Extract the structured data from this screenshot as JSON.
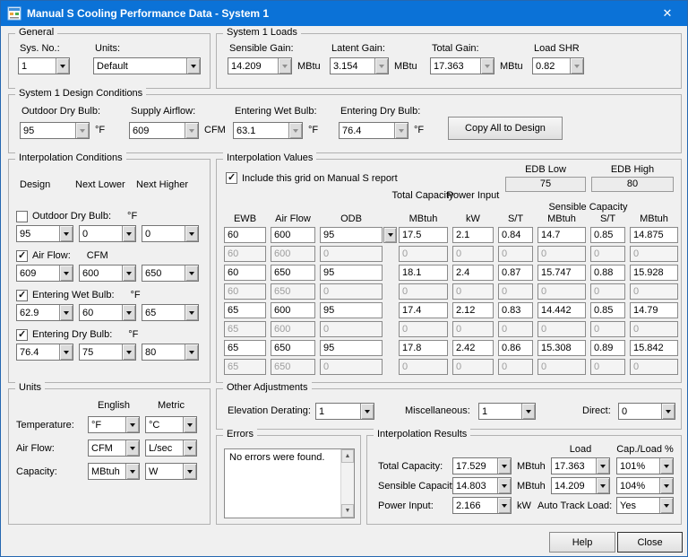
{
  "colors": {
    "titlebar": "#0b72d7",
    "dialog_bg": "#f0f0f0"
  },
  "titlebar": {
    "title": "Manual S Cooling Performance Data - System 1",
    "close_glyph": "✕"
  },
  "general": {
    "legend": "General",
    "sys_no_label": "Sys. No.:",
    "sys_no_value": "1",
    "units_label": "Units:",
    "units_value": "Default"
  },
  "loads": {
    "legend": "System 1 Loads",
    "sensible_label": "Sensible Gain:",
    "sensible_value": "14.209",
    "sensible_unit": "MBtu",
    "latent_label": "Latent Gain:",
    "latent_value": "3.154",
    "latent_unit": "MBtu",
    "total_label": "Total Gain:",
    "total_value": "17.363",
    "total_unit": "MBtu",
    "shr_label": "Load SHR",
    "shr_value": "0.82"
  },
  "design": {
    "legend": "System 1 Design Conditions",
    "odb_label": "Outdoor Dry Bulb:",
    "odb_value": "95",
    "odb_unit": "°F",
    "airflow_label": "Supply Airflow:",
    "airflow_value": "609",
    "airflow_unit": "CFM",
    "ewb_label": "Entering Wet Bulb:",
    "ewb_value": "63.1",
    "ewb_unit": "°F",
    "edb_label": "Entering Dry Bulb:",
    "edb_value": "76.4",
    "edb_unit": "°F",
    "copy_button": "Copy All to Design"
  },
  "interp_conditions": {
    "legend": "Interpolation Conditions",
    "headers": {
      "design": "Design",
      "lower": "Next Lower",
      "higher": "Next Higher"
    },
    "rows": [
      {
        "label": "Outdoor Dry Bulb:",
        "unit": "°F",
        "checked": false,
        "design": "95",
        "lower": "0",
        "higher": "0"
      },
      {
        "label": "Air Flow:",
        "unit": "CFM",
        "checked": true,
        "design": "609",
        "lower": "600",
        "higher": "650"
      },
      {
        "label": "Entering Wet Bulb:",
        "unit": "°F",
        "checked": true,
        "design": "62.9",
        "lower": "60",
        "higher": "65"
      },
      {
        "label": "Entering Dry Bulb:",
        "unit": "°F",
        "checked": true,
        "design": "76.4",
        "lower": "75",
        "higher": "80"
      }
    ]
  },
  "interp_values": {
    "legend": "Interpolation Values",
    "include_label": "Include this grid on Manual S report",
    "include_checked": true,
    "edb_low_label": "EDB Low",
    "edb_high_label": "EDB High",
    "edb_low_value": "75",
    "edb_high_value": "80",
    "group_total": "Total Capacity",
    "group_power": "Power Input",
    "group_sensible": "Sensible Capacity",
    "col_headers": [
      "EWB",
      "Air Flow",
      "ODB",
      "MBtuh",
      "kW",
      "S/T",
      "MBtuh",
      "S/T",
      "MBtuh"
    ],
    "rows": [
      {
        "disabled": false,
        "cells": [
          "60",
          "600",
          "95",
          "17.5",
          "2.1",
          "0.84",
          "14.7",
          "0.85",
          "14.875"
        ]
      },
      {
        "disabled": true,
        "cells": [
          "60",
          "600",
          "0",
          "0",
          "0",
          "0",
          "0",
          "0",
          "0"
        ]
      },
      {
        "disabled": false,
        "cells": [
          "60",
          "650",
          "95",
          "18.1",
          "2.4",
          "0.87",
          "15.747",
          "0.88",
          "15.928"
        ]
      },
      {
        "disabled": true,
        "cells": [
          "60",
          "650",
          "0",
          "0",
          "0",
          "0",
          "0",
          "0",
          "0"
        ]
      },
      {
        "disabled": false,
        "cells": [
          "65",
          "600",
          "95",
          "17.4",
          "2.12",
          "0.83",
          "14.442",
          "0.85",
          "14.79"
        ]
      },
      {
        "disabled": true,
        "cells": [
          "65",
          "600",
          "0",
          "0",
          "0",
          "0",
          "0",
          "0",
          "0"
        ]
      },
      {
        "disabled": false,
        "cells": [
          "65",
          "650",
          "95",
          "17.8",
          "2.42",
          "0.86",
          "15.308",
          "0.89",
          "15.842"
        ]
      },
      {
        "disabled": true,
        "cells": [
          "65",
          "650",
          "0",
          "0",
          "0",
          "0",
          "0",
          "0",
          "0"
        ]
      }
    ]
  },
  "units": {
    "legend": "Units",
    "english_header": "English",
    "metric_header": "Metric",
    "rows": [
      {
        "label": "Temperature:",
        "english": "°F",
        "metric": "°C"
      },
      {
        "label": "Air Flow:",
        "english": "CFM",
        "metric": "L/sec"
      },
      {
        "label": "Capacity:",
        "english": "MBtuh",
        "metric": "W"
      }
    ]
  },
  "adjustments": {
    "legend": "Other Adjustments",
    "elevation_label": "Elevation Derating:",
    "elevation_value": "1",
    "misc_label": "Miscellaneous:",
    "misc_value": "1",
    "direct_label": "Direct:",
    "direct_value": "0"
  },
  "errors": {
    "legend": "Errors",
    "message": "No errors were found."
  },
  "results": {
    "legend": "Interpolation Results",
    "load_header": "Load",
    "cap_header": "Cap./Load %",
    "total_label": "Total Capacity:",
    "total_value": "17.529",
    "total_unit": "MBtuh",
    "total_load": "17.363",
    "total_pct": "101%",
    "sensible_label": "Sensible Capacity:",
    "sensible_value": "14.803",
    "sensible_unit": "MBtuh",
    "sensible_load": "14.209",
    "sensible_pct": "104%",
    "power_label": "Power Input:",
    "power_value": "2.166",
    "power_unit": "kW",
    "auto_track_label": "Auto Track Load:",
    "auto_track_value": "Yes"
  },
  "footer": {
    "help_button": "Help",
    "close_button": "Close"
  }
}
